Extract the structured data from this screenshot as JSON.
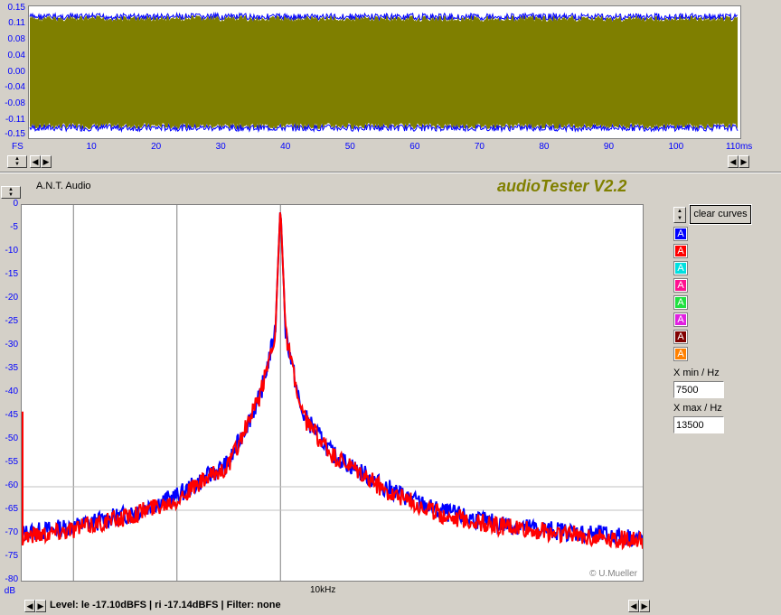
{
  "colors": {
    "waveform_fill": "#7f7f00",
    "channel_blue": "#0000ff",
    "channel_red": "#ff0000",
    "axis_text": "#0000ff",
    "title": "#808000"
  },
  "time_plot": {
    "y_ticks": [
      "0.15",
      "0.11",
      "0.08",
      "0.04",
      "0.00",
      "-0.04",
      "-0.08",
      "-0.11",
      "-0.15"
    ],
    "x_ticks": [
      "10",
      "20",
      "30",
      "40",
      "50",
      "60",
      "70",
      "80",
      "90",
      "100"
    ],
    "x_start_label": "FS",
    "x_end_label": "110ms"
  },
  "app": {
    "device": "A.N.T. Audio",
    "title": "audioTester V2.2",
    "copyright": "© U.Mueller"
  },
  "spectrum": {
    "y_ticks": [
      "0",
      "-5",
      "-10",
      "-15",
      "-20",
      "-25",
      "-30",
      "-35",
      "-40",
      "-45",
      "-50",
      "-55",
      "-60",
      "-65",
      "-70",
      "-75",
      "-80"
    ],
    "y_unit": "dB",
    "x_center_label": "10kHz"
  },
  "side_panel": {
    "clear_button": "clear curves",
    "channels": [
      {
        "label": "A",
        "color": "#0000ff"
      },
      {
        "label": "A",
        "color": "#ff0000"
      },
      {
        "label": "A",
        "color": "#00e0e0"
      },
      {
        "label": "A",
        "color": "#ff1090"
      },
      {
        "label": "A",
        "color": "#20e040"
      },
      {
        "label": "A",
        "color": "#e020e0"
      },
      {
        "label": "A",
        "color": "#800000"
      },
      {
        "label": "A",
        "color": "#ff8000"
      }
    ],
    "xmin_label": "X min / Hz",
    "xmin_value": "7500",
    "xmax_label": "X max / Hz",
    "xmax_value": "13500"
  },
  "status": {
    "text": "Level: le -17.10dBFS | ri -17.14dBFS | Filter: none"
  },
  "chart_data": [
    {
      "type": "area",
      "xlabel": "",
      "ylabel": "",
      "xlim": [
        0,
        110
      ],
      "ylim": [
        -0.15,
        0.15
      ],
      "series": [
        {
          "values": [
            -0.13,
            0.13
          ]
        }
      ]
    },
    {
      "type": "line",
      "xlabel": "",
      "ylabel": "dB",
      "xlim": [
        7500,
        13500
      ],
      "ylim": [
        -80,
        0
      ],
      "x_center": 10000,
      "series": [
        {
          "color": "#0000ff",
          "x": [
            7500,
            8000,
            8500,
            9000,
            9500,
            9800,
            9950,
            10000,
            10050,
            10200,
            10500,
            11000,
            11500,
            12000,
            12500,
            13000,
            13500
          ],
          "values": [
            -70,
            -68.5,
            -66,
            -62,
            -55,
            -41,
            -27,
            0,
            -27,
            -44,
            -53,
            -60,
            -65,
            -67.5,
            -69,
            -70,
            -71
          ]
        },
        {
          "color": "#ff0000",
          "x": [
            7500,
            8000,
            8500,
            9000,
            9500,
            9800,
            9950,
            10000,
            10050,
            10200,
            10500,
            11000,
            11500,
            12000,
            12500,
            13000,
            13500
          ],
          "values": [
            -70.5,
            -69,
            -66.5,
            -62.5,
            -55.5,
            -41,
            -27,
            0,
            -27,
            -44.5,
            -53.5,
            -60.5,
            -65.5,
            -68,
            -69.5,
            -70.5,
            -71.5
          ]
        }
      ]
    }
  ]
}
